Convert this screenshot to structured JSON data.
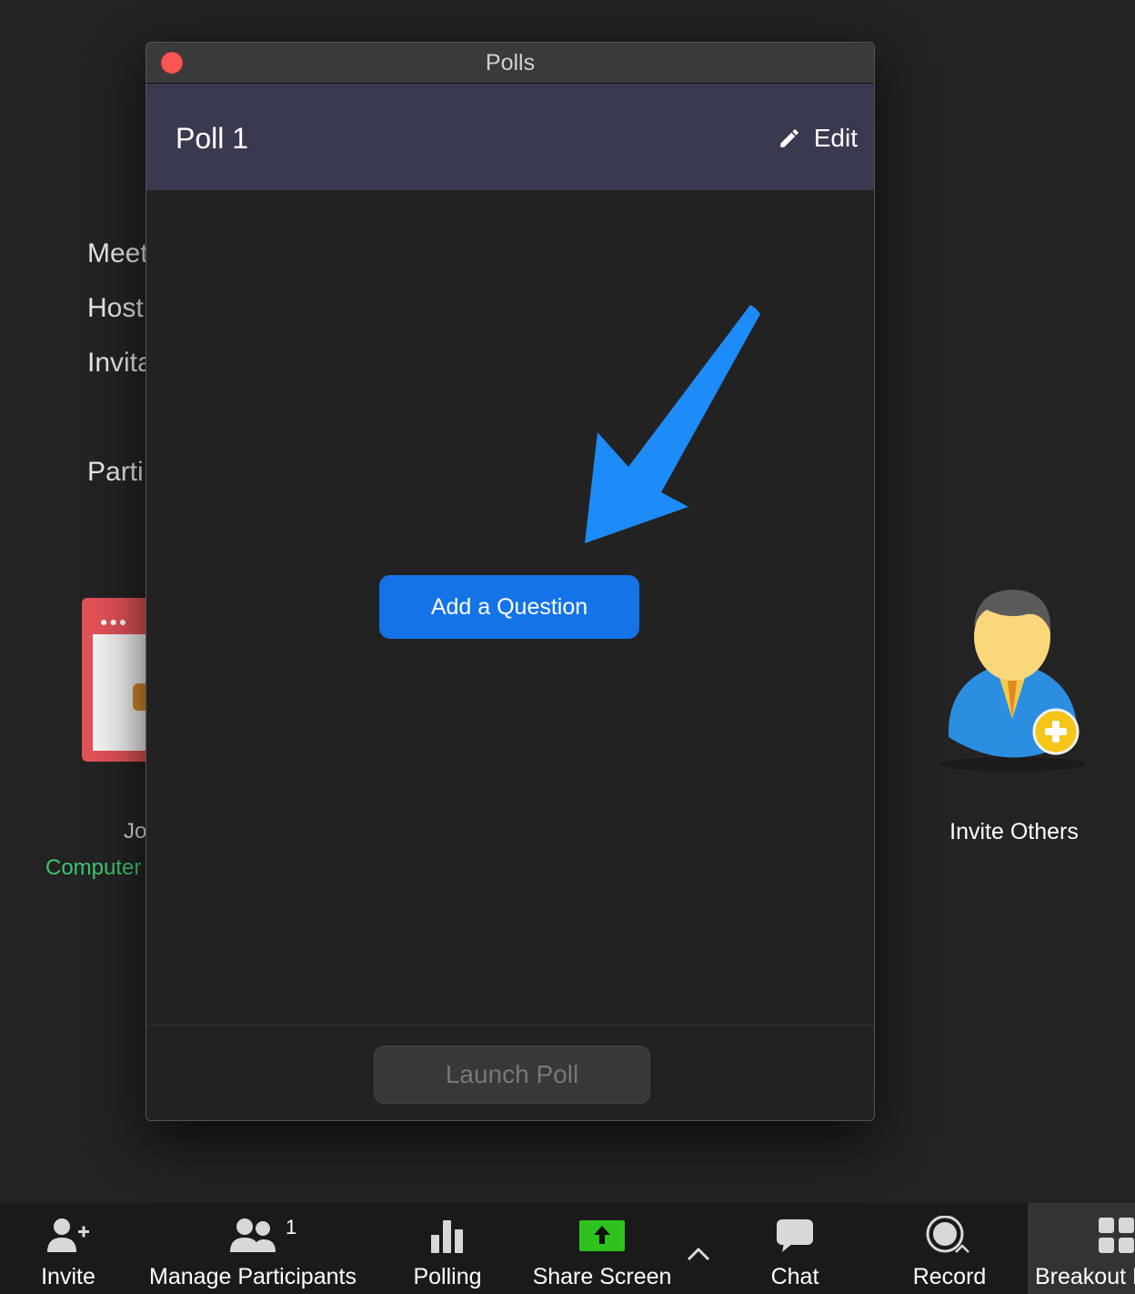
{
  "background": {
    "info_lines": [
      "Meet",
      "Host",
      "Invita",
      "Parti"
    ],
    "participant_name": "Jo",
    "audio_status": "Computer",
    "invite_others_label": "Invite Others"
  },
  "window": {
    "title": "Polls"
  },
  "poll": {
    "title": "Poll 1",
    "edit_label": "Edit",
    "add_question_label": "Add a Question",
    "launch_label": "Launch Poll"
  },
  "toolbar": {
    "invite": "Invite",
    "manage_participants": "Manage Participants",
    "participant_count": "1",
    "polling": "Polling",
    "share_screen": "Share Screen",
    "chat": "Chat",
    "record": "Record",
    "breakout": "Breakout R"
  },
  "colors": {
    "accent_blue": "#1573e8",
    "arrow_blue": "#1d8cf8",
    "share_green": "#2fc21f",
    "header_bg": "#393a50",
    "close_red": "#fc5753",
    "audio_green": "#3fc46e"
  }
}
